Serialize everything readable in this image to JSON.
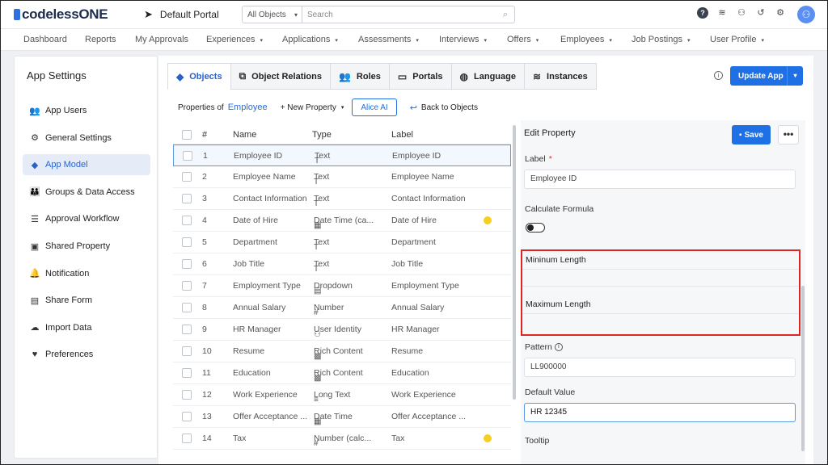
{
  "app": {
    "logo_text": "codelessONE",
    "portal_name": "Default Portal"
  },
  "search": {
    "scope": "All Objects",
    "placeholder": "Search"
  },
  "nav": [
    {
      "label": "Dashboard",
      "dropdown": false
    },
    {
      "label": "Reports",
      "dropdown": false
    },
    {
      "label": "My Approvals",
      "dropdown": false
    },
    {
      "label": "Experiences",
      "dropdown": true
    },
    {
      "label": "Applications",
      "dropdown": true
    },
    {
      "label": "Assessments",
      "dropdown": true
    },
    {
      "label": "Interviews",
      "dropdown": true
    },
    {
      "label": "Offers",
      "dropdown": true
    },
    {
      "label": "Employees",
      "dropdown": true
    },
    {
      "label": "Job Postings",
      "dropdown": true
    },
    {
      "label": "User Profile",
      "dropdown": true
    }
  ],
  "sidebar": {
    "title": "App Settings",
    "items": [
      {
        "label": "App Users",
        "icon": "users-icon",
        "glyph": "👥"
      },
      {
        "label": "General Settings",
        "icon": "gear-icon",
        "glyph": "⚙"
      },
      {
        "label": "App Model",
        "icon": "cube-icon",
        "glyph": "◆",
        "active": true
      },
      {
        "label": "Groups & Data Access",
        "icon": "group-icon",
        "glyph": "👪"
      },
      {
        "label": "Approval Workflow",
        "icon": "list-check-icon",
        "glyph": "☰"
      },
      {
        "label": "Shared Property",
        "icon": "inbox-icon",
        "glyph": "▣"
      },
      {
        "label": "Notification",
        "icon": "bell-icon",
        "glyph": "🔔"
      },
      {
        "label": "Share Form",
        "icon": "form-icon",
        "glyph": "▤"
      },
      {
        "label": "Import Data",
        "icon": "cloud-upload-icon",
        "glyph": "☁"
      },
      {
        "label": "Preferences",
        "icon": "hand-heart-icon",
        "glyph": "♥"
      }
    ]
  },
  "tabs": [
    {
      "label": "Objects",
      "icon": "cube-icon",
      "glyph": "◆",
      "active": true
    },
    {
      "label": "Object Relations",
      "icon": "relations-icon",
      "glyph": "⧉"
    },
    {
      "label": "Roles",
      "icon": "roles-icon",
      "glyph": "👥"
    },
    {
      "label": "Portals",
      "icon": "monitor-icon",
      "glyph": "▭"
    },
    {
      "label": "Language",
      "icon": "globe-icon",
      "glyph": "◍"
    },
    {
      "label": "Instances",
      "icon": "database-icon",
      "glyph": "≋"
    }
  ],
  "update_button": "Update App",
  "toolbar": {
    "properties_of": "Properties of",
    "object_name": "Employee",
    "new_property": "+ New Property",
    "alice": "Alice AI",
    "back": "Back to Objects"
  },
  "table": {
    "headers": {
      "num": "#",
      "name": "Name",
      "type": "Type",
      "label": "Label"
    },
    "rows": [
      {
        "num": "1",
        "name": "Employee ID",
        "type": "Text",
        "type_glyph": "T",
        "label": "Employee ID",
        "selected": true
      },
      {
        "num": "2",
        "name": "Employee Name",
        "type": "Text",
        "type_glyph": "T",
        "label": "Employee Name"
      },
      {
        "num": "3",
        "name": "Contact Information",
        "type": "Text",
        "type_glyph": "T",
        "label": "Contact Information"
      },
      {
        "num": "4",
        "name": "Date of Hire",
        "type": "Date Time (ca...",
        "type_glyph": "▦",
        "label": "Date of Hire",
        "dot": true
      },
      {
        "num": "5",
        "name": "Department",
        "type": "Text",
        "type_glyph": "T",
        "label": "Department"
      },
      {
        "num": "6",
        "name": "Job Title",
        "type": "Text",
        "type_glyph": "T",
        "label": "Job Title"
      },
      {
        "num": "7",
        "name": "Employment Type",
        "type": "Dropdown",
        "type_glyph": "▤",
        "label": "Employment Type"
      },
      {
        "num": "8",
        "name": "Annual Salary",
        "type": "Number",
        "type_glyph": "#",
        "label": "Annual Salary"
      },
      {
        "num": "9",
        "name": "HR Manager",
        "type": "User Identity",
        "type_glyph": "⚇",
        "label": "HR Manager"
      },
      {
        "num": "10",
        "name": "Resume",
        "type": "Rich Content",
        "type_glyph": "▩",
        "label": "Resume"
      },
      {
        "num": "11",
        "name": "Education",
        "type": "Rich Content",
        "type_glyph": "▩",
        "label": "Education"
      },
      {
        "num": "12",
        "name": "Work Experience",
        "type": "Long Text",
        "type_glyph": "≡",
        "label": "Work Experience"
      },
      {
        "num": "13",
        "name": "Offer Acceptance ...",
        "type": "Date Time",
        "type_glyph": "▦",
        "label": "Offer Acceptance ..."
      },
      {
        "num": "14",
        "name": "Tax",
        "type": "Number (calc...",
        "type_glyph": "#",
        "label": "Tax",
        "dot": true
      }
    ]
  },
  "edit": {
    "title": "Edit Property",
    "save": "Save",
    "more": "•••",
    "label_label": "Label",
    "label_required": "*",
    "label_value": "Employee ID",
    "calc_formula": "Calculate Formula",
    "min_length": "Mininum Length",
    "max_length": "Maximum Length",
    "pattern": "Pattern",
    "pattern_value": "LL900000",
    "default_value": "Default Value",
    "default_value_value": "HR 12345",
    "tooltip": "Tooltip",
    "calc_formula_enabled": false
  },
  "colors": {
    "accent": "#1f6fe5",
    "highlight": "#e02424",
    "dot": "#f5d020"
  }
}
